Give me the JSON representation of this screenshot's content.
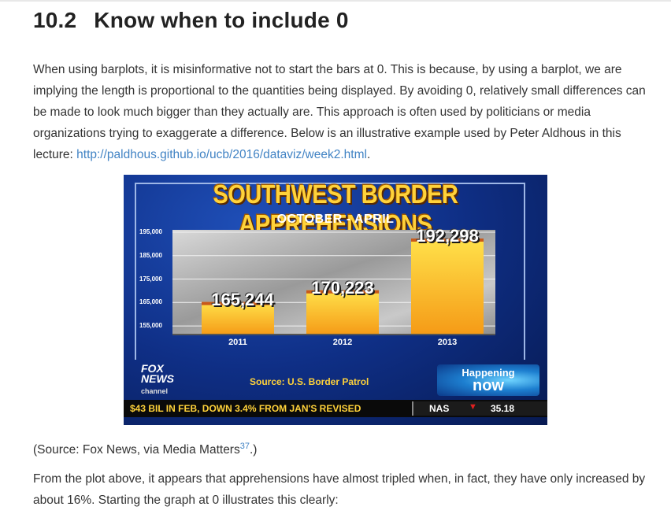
{
  "section": {
    "number": "10.2",
    "title": "Know when to include 0"
  },
  "intro": {
    "text": "When using barplots, it is misinformative not to start the bars at 0. This is because, by using a barplot, we are implying the length is proportional to the quantities being displayed. By avoiding 0, relatively small differences can be made to look much bigger than they actually are. This approach is often used by politicians or media organizations trying to exaggerate a difference. Below is an illustrative example used by Peter Aldhous in this lecture: ",
    "link_text": "http://paldhous.github.io/ucb/2016/dataviz/week2.html",
    "after_link": "."
  },
  "figure": {
    "headline": "SOUTHWEST BORDER APPREHENSIONS",
    "subhead": "OCTOBER - APRIL",
    "logo_line1": "FOX",
    "logo_line2": "NEWS",
    "logo_channel": "channel",
    "source": "Source: U.S. Border Patrol",
    "happening_1": "Happening",
    "happening_2": "now",
    "ticker_text": "$43 BIL IN FEB, DOWN 3.4% FROM JAN'S REVISED",
    "ticker_index": "NAS",
    "ticker_arrow": "▼",
    "ticker_value": "35.18"
  },
  "chart_data": {
    "type": "bar",
    "title": "SOUTHWEST BORDER APPREHENSIONS",
    "subtitle": "OCTOBER - APRIL",
    "categories": [
      "2011",
      "2012",
      "2013"
    ],
    "values": [
      165244,
      170223,
      192298
    ],
    "data_labels": [
      "165,244",
      "170,223",
      "192,298"
    ],
    "yticks": [
      195000,
      185000,
      175000,
      165000,
      155000
    ],
    "ytick_labels": [
      "195,000",
      "185,000",
      "175,000",
      "165,000",
      "155,000"
    ],
    "ylim": [
      151000,
      196000
    ],
    "grid": true,
    "colors": {
      "bar_top": "#ffe14a",
      "bar_bottom": "#f59a16",
      "cap": "#c8591a"
    }
  },
  "caption": {
    "before": "(Source: Fox News, via Media Matters",
    "ref": "37",
    "after": ".)"
  },
  "conclusion": {
    "text": "From the plot above, it appears that apprehensions have almost tripled when, in fact, they have only increased by about 16%. Starting the graph at 0 illustrates this clearly:"
  }
}
